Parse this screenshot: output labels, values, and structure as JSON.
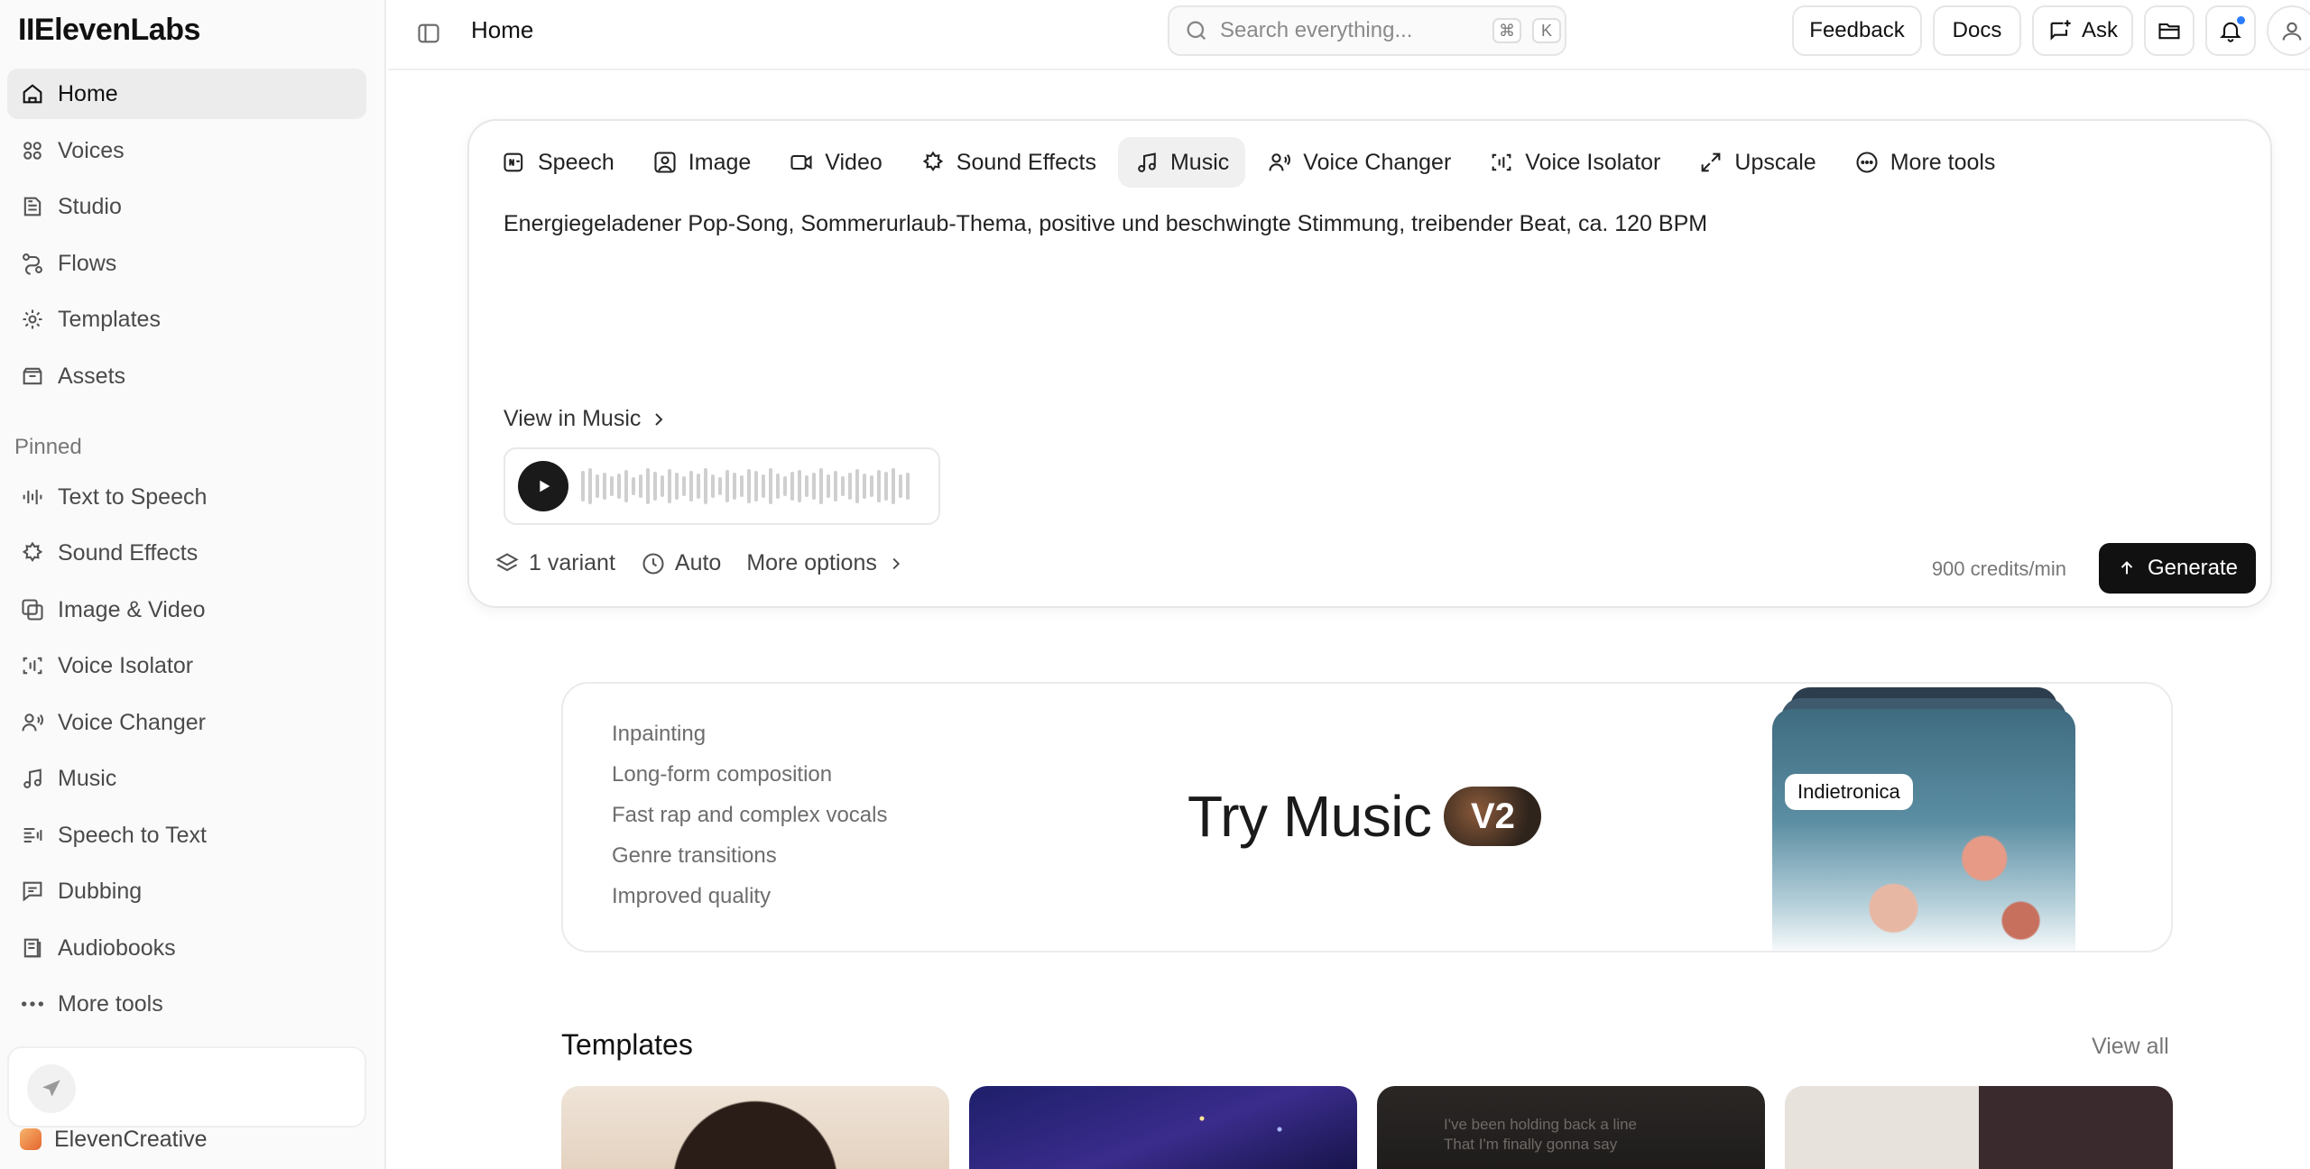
{
  "app": {
    "logo": "IIElevenLabs"
  },
  "sidebar": {
    "main_items": [
      {
        "label": "Home",
        "icon": "home-icon"
      },
      {
        "label": "Voices",
        "icon": "voices-icon"
      },
      {
        "label": "Studio",
        "icon": "studio-icon"
      },
      {
        "label": "Flows",
        "icon": "flows-icon"
      },
      {
        "label": "Templates",
        "icon": "templates-icon"
      },
      {
        "label": "Assets",
        "icon": "assets-icon"
      }
    ],
    "pinned_label": "Pinned",
    "pinned_items": [
      {
        "label": "Text to Speech",
        "icon": "waveform-icon"
      },
      {
        "label": "Sound Effects",
        "icon": "sound-effects-icon"
      },
      {
        "label": "Image & Video",
        "icon": "image-video-icon"
      },
      {
        "label": "Voice Isolator",
        "icon": "voice-isolator-icon"
      },
      {
        "label": "Voice Changer",
        "icon": "voice-changer-icon"
      },
      {
        "label": "Music",
        "icon": "music-icon"
      },
      {
        "label": "Speech to Text",
        "icon": "speech-to-text-icon"
      },
      {
        "label": "Dubbing",
        "icon": "dubbing-icon"
      },
      {
        "label": "Audiobooks",
        "icon": "audiobooks-icon"
      },
      {
        "label": "More tools",
        "icon": "more-dots-icon"
      }
    ],
    "workspace": "ElevenCreative"
  },
  "topbar": {
    "breadcrumb": "Home",
    "search_placeholder": "Search everything...",
    "shortcut_keys": [
      "⌘",
      "K"
    ],
    "feedback_label": "Feedback",
    "docs_label": "Docs",
    "ask_label": "Ask"
  },
  "generator": {
    "tabs": [
      {
        "label": "Speech",
        "icon": "speech-icon"
      },
      {
        "label": "Image",
        "icon": "image-icon"
      },
      {
        "label": "Video",
        "icon": "video-icon"
      },
      {
        "label": "Sound Effects",
        "icon": "sound-effects-icon"
      },
      {
        "label": "Music",
        "icon": "music-icon",
        "active": true
      },
      {
        "label": "Voice Changer",
        "icon": "voice-changer-icon"
      },
      {
        "label": "Voice Isolator",
        "icon": "voice-isolator-icon"
      },
      {
        "label": "Upscale",
        "icon": "upscale-icon"
      },
      {
        "label": "More tools",
        "icon": "more-tools-icon"
      }
    ],
    "prompt": "Energiegeladener Pop-Song, Sommerurlaub-Thema, positive und beschwingte Stimmung, treibender Beat, ca. 120 BPM",
    "view_in_label": "View in Music",
    "variants_label": "1 variant",
    "duration_label": "Auto",
    "more_options_label": "More options",
    "credits_label": "900 credits/min",
    "generate_label": "Generate"
  },
  "promo": {
    "features": [
      "Inpainting",
      "Long-form composition",
      "Fast rap and complex vocals",
      "Genre transitions",
      "Improved quality"
    ],
    "headline": "Try Music",
    "badge": "V2",
    "art_tag": "Indietronica"
  },
  "templates": {
    "title": "Templates",
    "view_all_label": "View all",
    "thumb3_lyrics": "I've been holding back a line\nThat I'm finally gonna say"
  },
  "colors": {
    "accent": "#111111",
    "sidebar_bg": "#fafafa",
    "notification_dot": "#2b7cff"
  }
}
